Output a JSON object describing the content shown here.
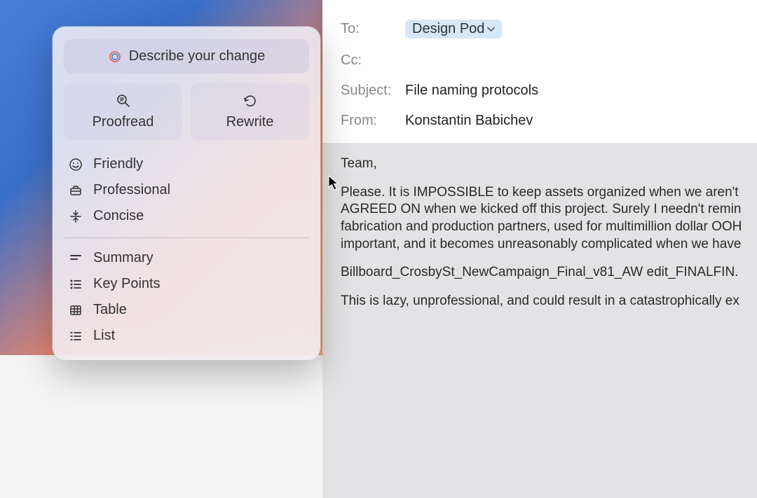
{
  "writing_tools": {
    "describe_label": "Describe your change",
    "proofread_label": "Proofread",
    "rewrite_label": "Rewrite",
    "tones": [
      {
        "label": "Friendly",
        "icon": "smile-icon"
      },
      {
        "label": "Professional",
        "icon": "briefcase-icon"
      },
      {
        "label": "Concise",
        "icon": "compress-icon"
      }
    ],
    "formats": [
      {
        "label": "Summary",
        "icon": "summary-icon"
      },
      {
        "label": "Key Points",
        "icon": "bullets-icon"
      },
      {
        "label": "Table",
        "icon": "table-icon"
      },
      {
        "label": "List",
        "icon": "list-icon"
      }
    ]
  },
  "email": {
    "to_label": "To:",
    "to_recipient": "Design Pod",
    "cc_label": "Cc:",
    "subject_label": "Subject:",
    "subject_value": "File naming protocols",
    "from_label": "From:",
    "from_value": "Konstantin Babichev",
    "body": {
      "greeting": "Team,",
      "p1": "Please. It is IMPOSSIBLE to keep assets organized when we aren't AGREED ON when we kicked off this project. Surely I needn't remin fabrication and production partners, used for multimillion dollar OOH important, and it becomes unreasonably complicated when we have",
      "p2": "Billboard_CrosbySt_NewCampaign_Final_v81_AW edit_FINALFIN.",
      "p3": "This is lazy, unprofessional, and could result in a catastrophically ex"
    }
  }
}
